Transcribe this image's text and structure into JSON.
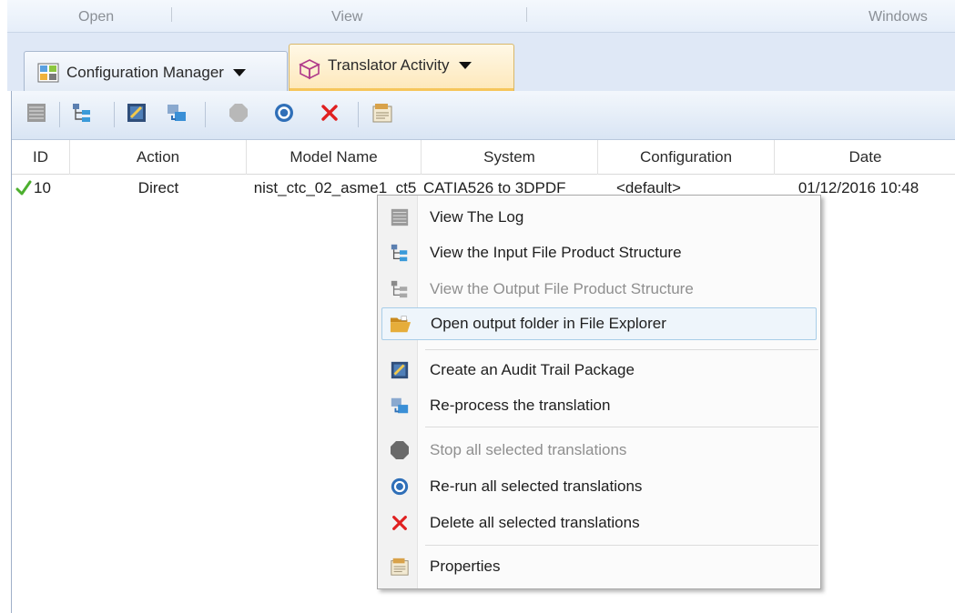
{
  "ribbon": {
    "groups": [
      "Open",
      "View",
      "Windows"
    ]
  },
  "tabs": [
    {
      "label": "Configuration Manager",
      "icon": "config-manager-icon",
      "active": false
    },
    {
      "label": "Translator Activity",
      "icon": "translator-activity-icon",
      "active": true
    }
  ],
  "toolbar": {
    "buttons": [
      "log-icon",
      "input-structure-icon",
      "audit-trail-icon",
      "reprocess-icon",
      "stop-icon",
      "rerun-icon",
      "delete-icon",
      "properties-icon"
    ]
  },
  "table": {
    "columns": [
      "ID",
      "Action",
      "Model Name",
      "System",
      "Configuration",
      "Date"
    ],
    "rows": [
      {
        "status": "success",
        "id": "10",
        "action": "Direct",
        "model_name": "nist_ctc_02_asme1_ct5",
        "system": "CATIA526 to 3DPDF",
        "configuration": "<default>",
        "date": "01/12/2016 10:48"
      }
    ]
  },
  "context_menu": {
    "items": [
      {
        "label": "View The Log",
        "icon": "log-icon",
        "enabled": true
      },
      {
        "label": "View the Input File Product Structure",
        "icon": "input-structure-icon",
        "enabled": true
      },
      {
        "label": "View the Output File Product Structure",
        "icon": "output-structure-icon",
        "enabled": false
      },
      {
        "label": "Open output folder in File Explorer",
        "icon": "folder-open-icon",
        "enabled": true,
        "highlighted": true
      },
      {
        "label": "Create an Audit Trail Package",
        "icon": "audit-trail-icon",
        "enabled": true
      },
      {
        "label": "Re-process the translation",
        "icon": "reprocess-icon",
        "enabled": true
      },
      {
        "label": "Stop all selected translations",
        "icon": "stop-icon",
        "enabled": false
      },
      {
        "label": "Re-run all selected translations",
        "icon": "rerun-icon",
        "enabled": true
      },
      {
        "label": "Delete all selected translations",
        "icon": "delete-icon",
        "enabled": true
      },
      {
        "label": "Properties",
        "icon": "properties-icon",
        "enabled": true
      }
    ]
  },
  "colors": {
    "active_tab_accent": "#f6c65c",
    "success_check": "#4caf2e",
    "delete_red": "#e02020",
    "rerun_blue": "#2f6fb8",
    "menu_highlight_border": "#a8cde8"
  }
}
